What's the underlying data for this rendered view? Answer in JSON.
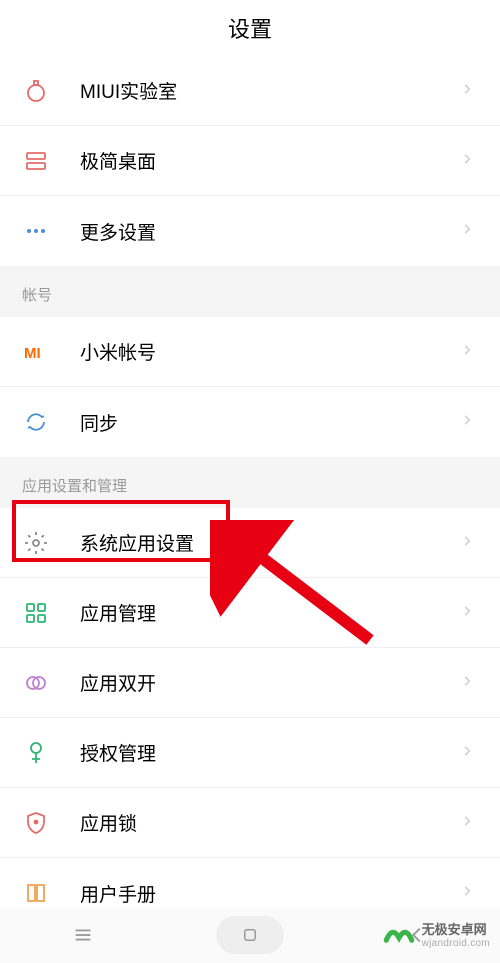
{
  "header": {
    "title": "设置"
  },
  "sections": [
    {
      "items": [
        {
          "name": "miui-lab",
          "label": "MIUI实验室",
          "iconColor": "#e56b6b"
        },
        {
          "name": "minimal-desktop",
          "label": "极简桌面",
          "iconColor": "#e56b6b"
        },
        {
          "name": "more-settings",
          "label": "更多设置",
          "iconColor": "#4a90d9"
        }
      ]
    },
    {
      "title": "帐号",
      "items": [
        {
          "name": "mi-account",
          "label": "小米帐号",
          "iconColor": "#ff6900"
        },
        {
          "name": "sync",
          "label": "同步",
          "iconColor": "#4a90d9"
        }
      ]
    },
    {
      "title": "应用设置和管理",
      "items": [
        {
          "name": "system-app-settings",
          "label": "系统应用设置",
          "iconColor": "#888",
          "highlight": true
        },
        {
          "name": "app-management",
          "label": "应用管理",
          "iconColor": "#2bb673"
        },
        {
          "name": "dual-apps",
          "label": "应用双开",
          "iconColor": "#c080d0"
        },
        {
          "name": "permission-management",
          "label": "授权管理",
          "iconColor": "#2bb673"
        },
        {
          "name": "app-lock",
          "label": "应用锁",
          "iconColor": "#e56b6b"
        },
        {
          "name": "user-manual",
          "label": "用户手册",
          "iconColor": "#f0a050"
        }
      ]
    }
  ],
  "watermark": {
    "line1": "无极安卓网",
    "line2": "wjandroid.com"
  },
  "colors": {
    "highlight": "#e60012",
    "arrow": "#e60012"
  }
}
